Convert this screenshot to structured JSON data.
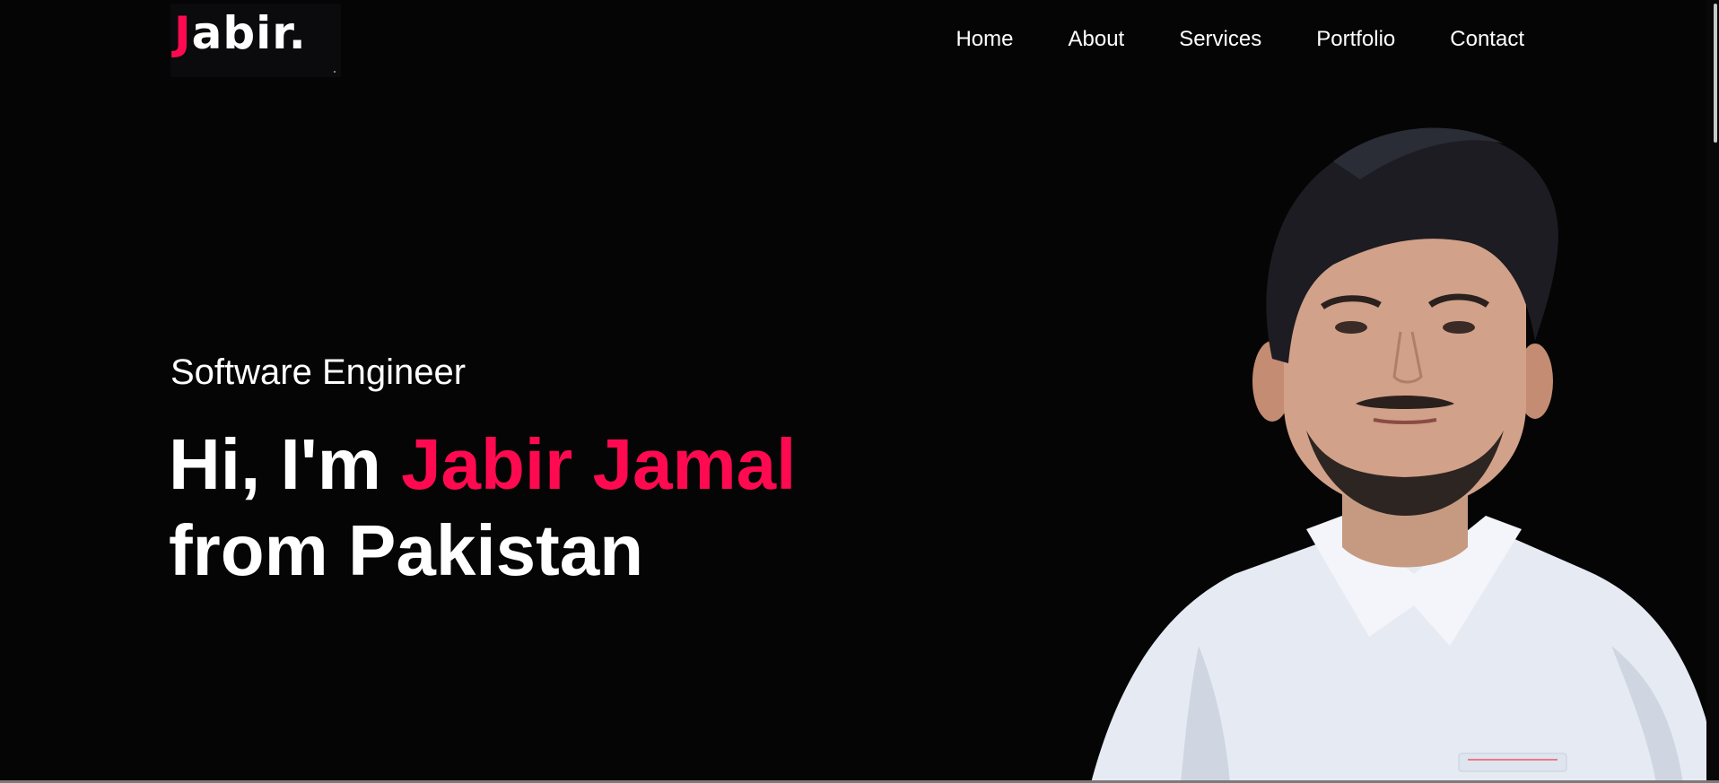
{
  "logo": {
    "first_letter": "J",
    "rest": "abir."
  },
  "nav": {
    "items": [
      "Home",
      "About",
      "Services",
      "Portfolio",
      "Contact"
    ]
  },
  "hero": {
    "subtitle": "Software Engineer",
    "greeting": "Hi, I'm ",
    "name": "Jabir Jamal",
    "location_line": "from Pakistan"
  },
  "colors": {
    "accent": "#ff0a50",
    "background": "#050505",
    "text": "#ffffff"
  }
}
